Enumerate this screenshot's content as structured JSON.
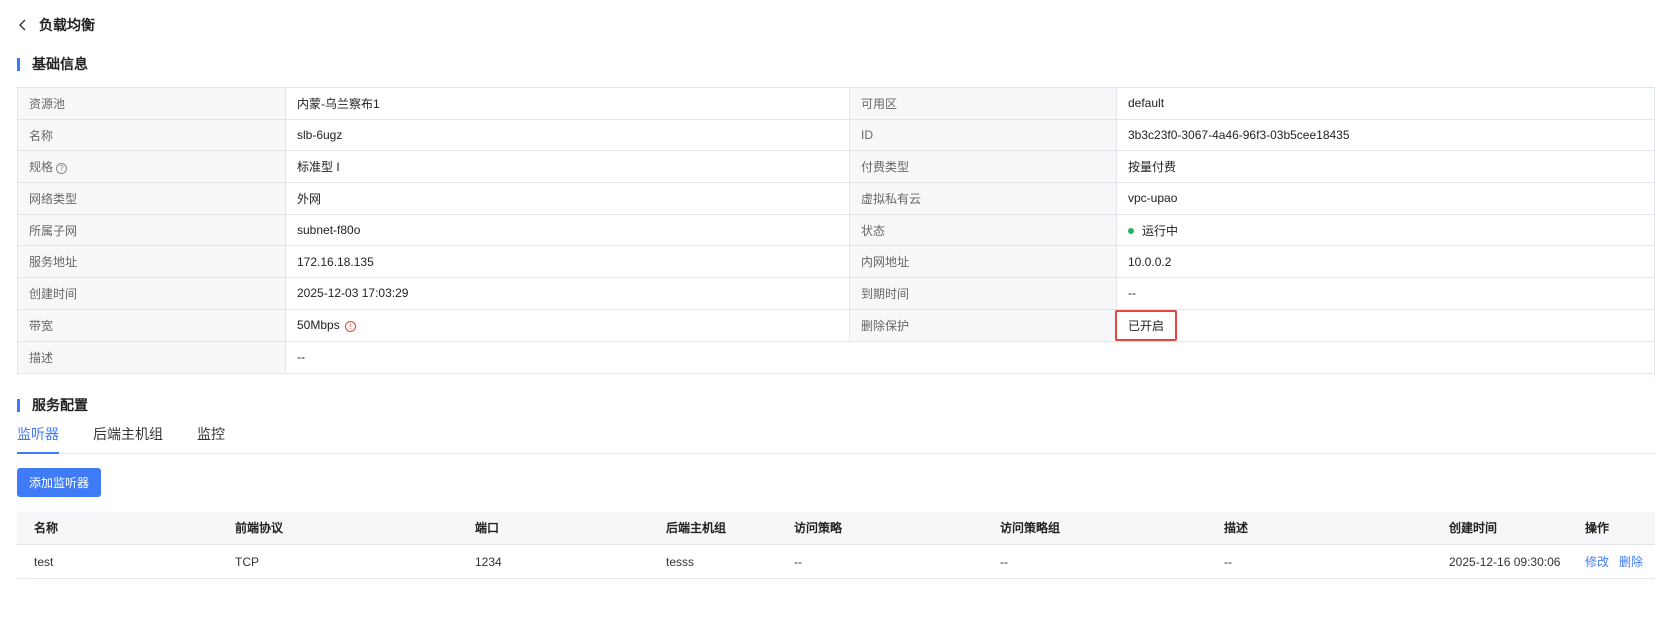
{
  "header": {
    "title": "负载均衡"
  },
  "basic": {
    "title": "基础信息",
    "rows": [
      [
        "资源池",
        "内蒙-乌兰察布1",
        "可用区",
        "default"
      ],
      [
        "名称",
        "slb-6ugz",
        "ID",
        "3b3c23f0-3067-4a46-96f3-03b5cee18435"
      ],
      [
        "规格",
        "标准型 I",
        "付费类型",
        "按量付费"
      ],
      [
        "网络类型",
        "外网",
        "虚拟私有云",
        "vpc-upao"
      ],
      [
        "所属子网",
        "subnet-f80o",
        "状态",
        "运行中"
      ],
      [
        "服务地址",
        "172.16.18.135",
        "内网地址",
        "10.0.0.2"
      ],
      [
        "创建时间",
        "2025-12-03 17:03:29",
        "到期时间",
        "--"
      ],
      [
        "带宽",
        "50Mbps",
        "删除保护",
        "已开启"
      ],
      [
        "描述",
        "--"
      ]
    ],
    "status_color": "#22b35e"
  },
  "service": {
    "title": "服务配置",
    "tabs": [
      "监听器",
      "后端主机组",
      "监控"
    ],
    "add_button": "添加监听器",
    "columns": [
      "名称",
      "前端协议",
      "端口",
      "后端主机组",
      "访问策略",
      "访问策略组",
      "描述",
      "创建时间",
      "操作"
    ],
    "rows": [
      {
        "name": "test",
        "protocol": "TCP",
        "port": "1234",
        "group": "tesss",
        "policy": "--",
        "policy_group": "--",
        "desc": "--",
        "created": "2025-12-16 09:30:06",
        "edit": "修改",
        "delete": "删除"
      }
    ]
  },
  "accent": "#3f7bf7"
}
